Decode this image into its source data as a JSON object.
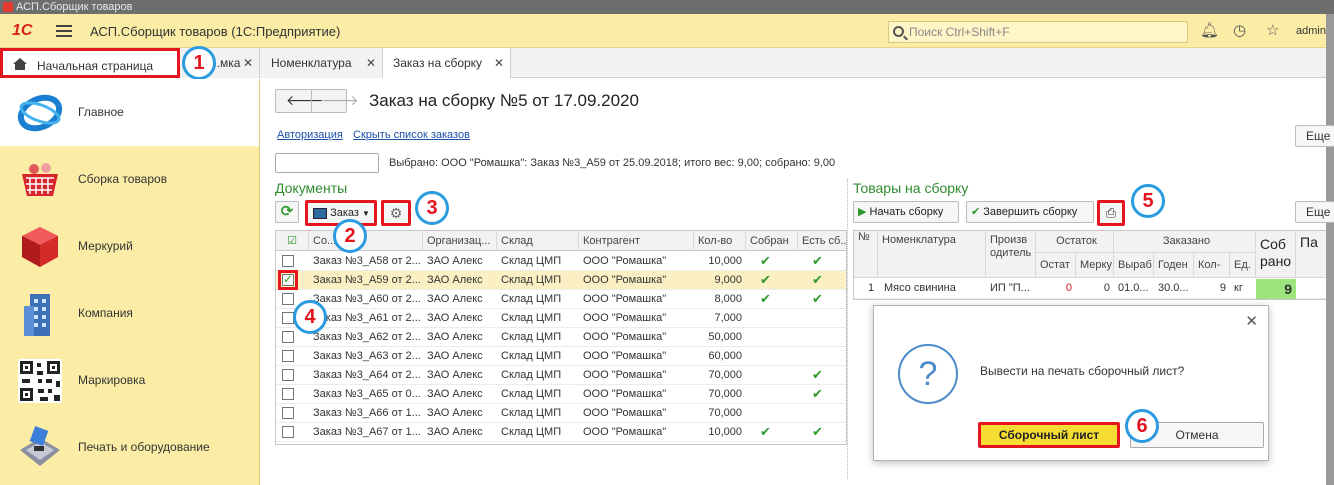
{
  "window": {
    "os_title": "АСП.Сборщик товаров"
  },
  "header": {
    "app_title": "АСП.Сборщик товаров  (1С:Предприятие)",
    "search_placeholder": "Поиск Ctrl+Shift+F",
    "user": "admin",
    "icons": [
      "bell-icon",
      "history-icon",
      "star-icon"
    ]
  },
  "tabs": [
    {
      "label": "Начальная страница",
      "close": ""
    },
    {
      "label": "...мка",
      "close": "✕"
    },
    {
      "label": "Номенклатура",
      "close": "✕"
    },
    {
      "label": "Заказ на сборку",
      "close": "✕"
    }
  ],
  "sidebar": {
    "items": [
      {
        "label": "Главное",
        "icon": "main-globe-icon"
      },
      {
        "label": "Сборка товаров",
        "icon": "basket-icon"
      },
      {
        "label": "Меркурий",
        "icon": "cube-icon"
      },
      {
        "label": "Компания",
        "icon": "building-icon"
      },
      {
        "label": "Маркировка",
        "icon": "qr-code-icon"
      },
      {
        "label": "Печать и оборудование",
        "icon": "card-terminal-icon"
      }
    ]
  },
  "document": {
    "title": "Заказ на сборку №5 от 17.09.2020",
    "nav_back": "🡐",
    "nav_forward": "🡒",
    "link_auth": "Авторизация",
    "link_hide": "Скрыть список заказов",
    "more_label": "Еще",
    "selected_text": "Выбрано: ООО \"Ромашка\": Заказ №3_А59 от 25.09.2018; итого вес: 9,00; собрано: 9,00"
  },
  "documents_panel": {
    "title": "Документы",
    "order_button": "Заказ",
    "columns": [
      "",
      "Со...",
      "Организац...",
      "Склад",
      "Контрагент",
      "Кол-во",
      "Собран",
      "Есть сб..."
    ],
    "rows": [
      {
        "checked": false,
        "doc": "Заказ №3_А58 от 2...",
        "org": "ЗАО Алекс",
        "wh": "Склад ЦМП",
        "contractor": "ООО \"Ромашка\"",
        "qty": "10,000",
        "collected": "✔",
        "has": "✔"
      },
      {
        "checked": true,
        "doc": "Заказ №3_А59 от 2...",
        "org": "ЗАО Алекс",
        "wh": "Склад ЦМП",
        "contractor": "ООО \"Ромашка\"",
        "qty": "9,000",
        "collected": "✔",
        "has": "✔"
      },
      {
        "checked": false,
        "doc": "Заказ №3_А60 от 2...",
        "org": "ЗАО Алекс",
        "wh": "Склад ЦМП",
        "contractor": "ООО \"Ромашка\"",
        "qty": "8,000",
        "collected": "✔",
        "has": "✔"
      },
      {
        "checked": false,
        "doc": "Заказ №3_А61 от 2...",
        "org": "ЗАО Алекс",
        "wh": "Склад ЦМП",
        "contractor": "ООО \"Ромашка\"",
        "qty": "7,000",
        "collected": "",
        "has": ""
      },
      {
        "checked": false,
        "doc": "Заказ №3_А62 от 2...",
        "org": "ЗАО Алекс",
        "wh": "Склад ЦМП",
        "contractor": "ООО \"Ромашка\"",
        "qty": "50,000",
        "collected": "",
        "has": ""
      },
      {
        "checked": false,
        "doc": "Заказ №3_А63 от 2...",
        "org": "ЗАО Алекс",
        "wh": "Склад ЦМП",
        "contractor": "ООО \"Ромашка\"",
        "qty": "60,000",
        "collected": "",
        "has": ""
      },
      {
        "checked": false,
        "doc": "Заказ №3_А64 от 2...",
        "org": "ЗАО Алекс",
        "wh": "Склад ЦМП",
        "contractor": "ООО \"Ромашка\"",
        "qty": "70,000",
        "collected": "",
        "has": "✔"
      },
      {
        "checked": false,
        "doc": "Заказ №3_А65 от 0...",
        "org": "ЗАО Алекс",
        "wh": "Склад ЦМП",
        "contractor": "ООО \"Ромашка\"",
        "qty": "70,000",
        "collected": "",
        "has": "✔"
      },
      {
        "checked": false,
        "doc": "Заказ №3_А66 от 1...",
        "org": "ЗАО Алекс",
        "wh": "Склад ЦМП",
        "contractor": "ООО \"Ромашка\"",
        "qty": "70,000",
        "collected": "",
        "has": ""
      },
      {
        "checked": false,
        "doc": "Заказ №3_А67 от 1...",
        "org": "ЗАО Алекс",
        "wh": "Склад ЦМП",
        "contractor": "ООО \"Ромашка\"",
        "qty": "10,000",
        "collected": "✔",
        "has": "✔"
      }
    ]
  },
  "goods_panel": {
    "title": "Товары на сборку",
    "start_button": "Начать сборку",
    "finish_button": "Завершить сборку",
    "more_label": "Еще",
    "columns": {
      "n": "№",
      "name": "Номенклатура",
      "producer": "Произв одитель",
      "stock": "Остаток",
      "stock_sub": [
        "Остат",
        "Мерку"
      ],
      "ordered": "Заказано",
      "ordered_sub": [
        "Выраб",
        "Годен",
        "Кол-",
        "Ед."
      ],
      "collected": "Соб рано",
      "pa": "Па"
    },
    "row": {
      "n": "1",
      "name": "Мясо свинина",
      "producer": "ИП \"П...",
      "stock": "0",
      "merc": "0",
      "made": "01.0...",
      "valid": "30.0...",
      "qty": "9",
      "unit": "кг",
      "collected": "9"
    }
  },
  "dialog": {
    "question": "Вывести на печать сборочный лист?",
    "primary": "Сборочный лист",
    "secondary": "Отмена",
    "close": "✕",
    "q_mark": "?"
  },
  "callouts": [
    "1",
    "2",
    "3",
    "4",
    "5",
    "6"
  ],
  "colors": {
    "accent_red": "#e4151f",
    "callout_blue": "#2a9be0",
    "sidebar_bg": "#fbeda6",
    "section_green": "#2f8c2f"
  }
}
